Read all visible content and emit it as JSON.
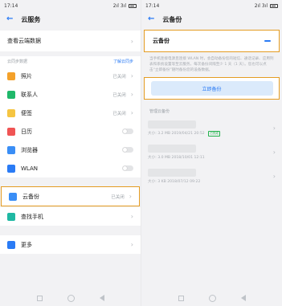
{
  "status": {
    "time": "17:14",
    "net": "2ıl 3ıl"
  },
  "left": {
    "title": "云服务",
    "view_cloud": "查看云端数据",
    "sync_section": "云同步数据",
    "sync_link": "了解云同步",
    "items": [
      {
        "label": "照片",
        "value": "已关闭",
        "icon_color": "#f4a12a",
        "control": "chevron"
      },
      {
        "label": "联系人",
        "value": "已关闭",
        "icon_color": "#1fb86a",
        "control": "chevron"
      },
      {
        "label": "便签",
        "value": "已关闭",
        "icon_color": "#f5c542",
        "control": "chevron"
      },
      {
        "label": "日历",
        "value": "",
        "icon_color": "#f05454",
        "control": "toggle"
      },
      {
        "label": "浏览器",
        "value": "",
        "icon_color": "#3a8ef6",
        "control": "toggle"
      },
      {
        "label": "WLAN",
        "value": "",
        "icon_color": "#2a7bf5",
        "control": "toggle"
      }
    ],
    "backup": {
      "label": "云备份",
      "value": "已关闭",
      "icon_color": "#3a8ef6"
    },
    "find_phone": {
      "label": "查找手机",
      "icon_color": "#1fb8a3"
    },
    "more": {
      "label": "更多",
      "icon_color": "#2a7bf5"
    }
  },
  "right": {
    "title": "云备份",
    "backup_label": "云备份",
    "description": "当手机连接电源且连接 WLAN 时，会自动备份您的短信、通话记录、应用列表和系统设置等至云服务，每次备份间隔至少 1 天（1 天）。您也可以点击“立即备份”随时备份您的设备数据。",
    "button": "立即备份",
    "list_title": "管理云备份",
    "records": [
      {
        "meta": "大小: 3.2 MB  2019/04/21 20:52",
        "badge": "已完成"
      },
      {
        "meta": "大小: 3.0 MB  2018/10/01 12:11",
        "badge": ""
      },
      {
        "meta": "大小: 3 KB  2018/07/12 09:22",
        "badge": ""
      }
    ]
  }
}
